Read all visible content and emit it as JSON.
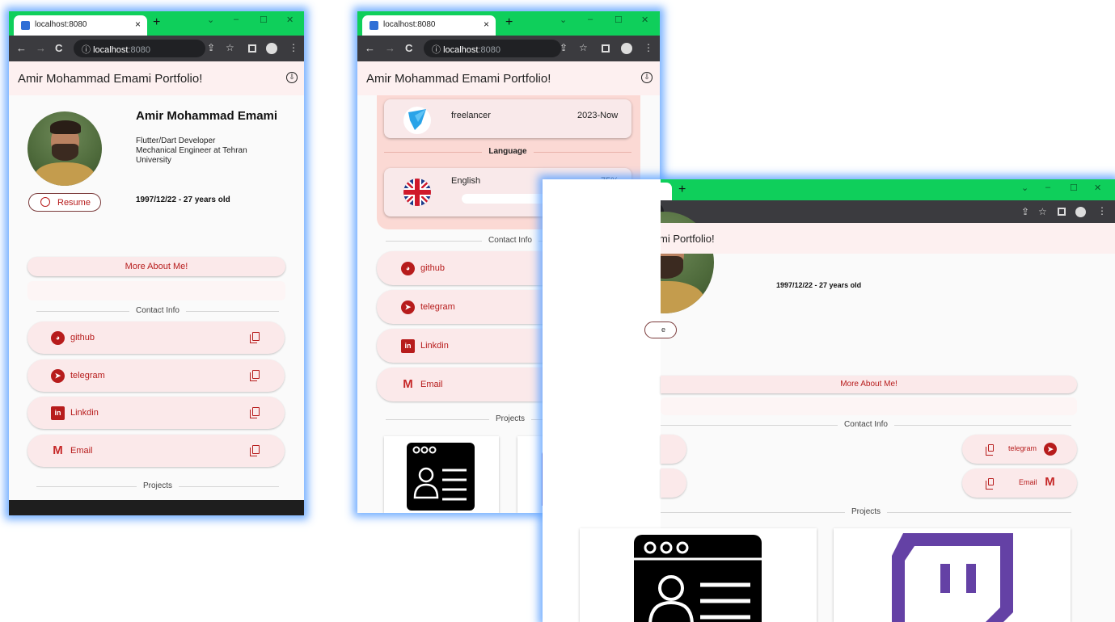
{
  "browser": {
    "tab_title": "localhost:8080",
    "new_tab": "+",
    "close": "×",
    "url_host": "localhost",
    "url_port": ":8080",
    "min": "–",
    "max": "☐",
    "winclose": "✕",
    "back": "←",
    "forward": "→",
    "reload": "C",
    "share": "⇪",
    "star": "☆",
    "menu": "⋮"
  },
  "app": {
    "title": "Amir Mohammad Emami Portfolio!",
    "title_partial": "mi Portfolio!",
    "download_icon": "⇩"
  },
  "profile": {
    "name": "Amir Mohammad Emami",
    "role_line1": "Flutter/Dart Developer",
    "role_line2": "Mechanical Engineer at Tehran",
    "role_line3": "University",
    "birth": "1997/12/22 - 27 years old",
    "resume_label": "Resume",
    "resume_partial": "e",
    "more_label": "More About Me!"
  },
  "experience": {
    "title": "freelancer",
    "period": "2023-Now"
  },
  "language": {
    "section_label": "Language",
    "name": "English",
    "percent_label": "75%",
    "level": 0.75
  },
  "contact": {
    "section_label": "Contact Info",
    "items": [
      {
        "label": "github"
      },
      {
        "label": "telegram"
      },
      {
        "label": "Linkdin"
      },
      {
        "label": "Email"
      }
    ]
  },
  "projects": {
    "section_label": "Projects"
  },
  "colors": {
    "accent": "#b71c1c",
    "tabbar": "#0fcf5b",
    "appbar": "#fdf0f0",
    "panel": "#fbd9d4",
    "twitch": "#6441a5"
  }
}
